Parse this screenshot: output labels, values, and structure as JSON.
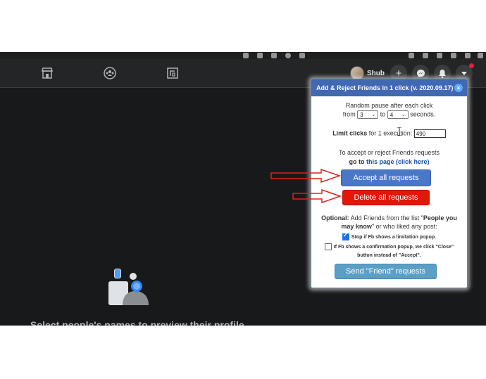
{
  "topbar": {
    "profile_name": "Shub"
  },
  "page": {
    "preview_prompt": "Select people's names to preview their profile"
  },
  "popup": {
    "title": "Add & Reject Friends in 1 click (v. 2020.09.17)",
    "close_icon": "×",
    "random_pause_label": "Random pause after each click",
    "from_label": "from",
    "from_value": "3",
    "to_label": "to",
    "to_value": "4",
    "seconds_label": "seconds.",
    "limit_bold": "Limit clicks",
    "limit_rest": "for 1 execution:",
    "limit_value": "490",
    "accept_reject_text": "To accept or reject Friends requests",
    "goto_text": "go to",
    "goto_link": "this page (click here)",
    "accept_button": "Accept all requests",
    "delete_button": "Delete all requests",
    "optional_bold": "Optional:",
    "optional_text": "Add Friends from the list \"",
    "people_bold": "People you may know",
    "optional_tail": "\" or who liked any post:",
    "stop_checkbox_label": "Stop if Fb shows a limitation popup.",
    "stop_checked": true,
    "confirm_checkbox_label": "If Fb shows a confirmation popup, we click \"Close\" button instead of \"Accept\".",
    "confirm_checked": false,
    "send_button": "Send \"Friend\" requests"
  },
  "colors": {
    "header": "#4168b2",
    "accept": "#4a78c8",
    "delete": "#e3160a",
    "send": "#5b9fc5",
    "annotation_arrow": "#e02020"
  },
  "icons": [
    "marketplace-icon",
    "groups-icon",
    "gaming-icon",
    "plus-icon",
    "messenger-icon",
    "bell-icon",
    "chevron-down-icon"
  ]
}
